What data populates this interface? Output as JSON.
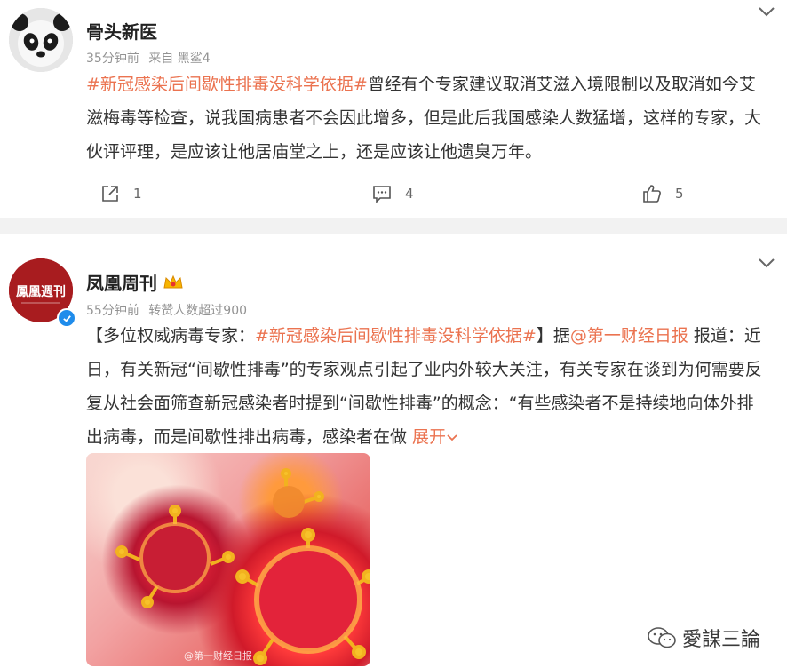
{
  "posts": [
    {
      "user": "骨头新医",
      "time": "35分钟前",
      "source": "来自 黑鲨4",
      "tag": "#新冠感染后间歇性排毒没科学依据#",
      "text": "曾经有个专家建议取消艾滋入境限制以及取消如今艾滋梅毒等检查，说我国病患者不会因此增多，但是此后我国感染人数猛增，这样的专家，大伙评评理，是应该让他居庙堂之上，还是应该让他遗臭万年。",
      "counts": {
        "repost": "1",
        "comment": "4",
        "like": "5"
      }
    },
    {
      "user": "凤凰周刊",
      "time": "55分钟前",
      "source": "转赞人数超过900",
      "text_prefix": "【多位权威病毒专家：",
      "tag": "#新冠感染后间歇性排毒没科学依据#",
      "text_mid": "】据",
      "mention": "@第一财经日报",
      "text_rest": " 报道：近日，有关新冠“间歇性排毒”的专家观点引起了业内外较大关注，有关专家在谈到为何需要反复从社会面筛查新冠感染者时提到“间歇性排毒”的概念：“有些感染者不是持续地向体外排出病毒，而是间歇性排出病毒，感染者在做 ",
      "expand": "展开",
      "image_watermark": "@第一财经日报",
      "avatar_text": "鳳凰週刊"
    }
  ],
  "watermark": "愛謀三論",
  "colors": {
    "accent": "#eb7350",
    "verified": "#1f8ceb"
  },
  "icons": [
    "chevron-down-icon",
    "share-icon",
    "comment-icon",
    "like-icon",
    "verified-icon",
    "crown-icon",
    "wechat-icon"
  ]
}
